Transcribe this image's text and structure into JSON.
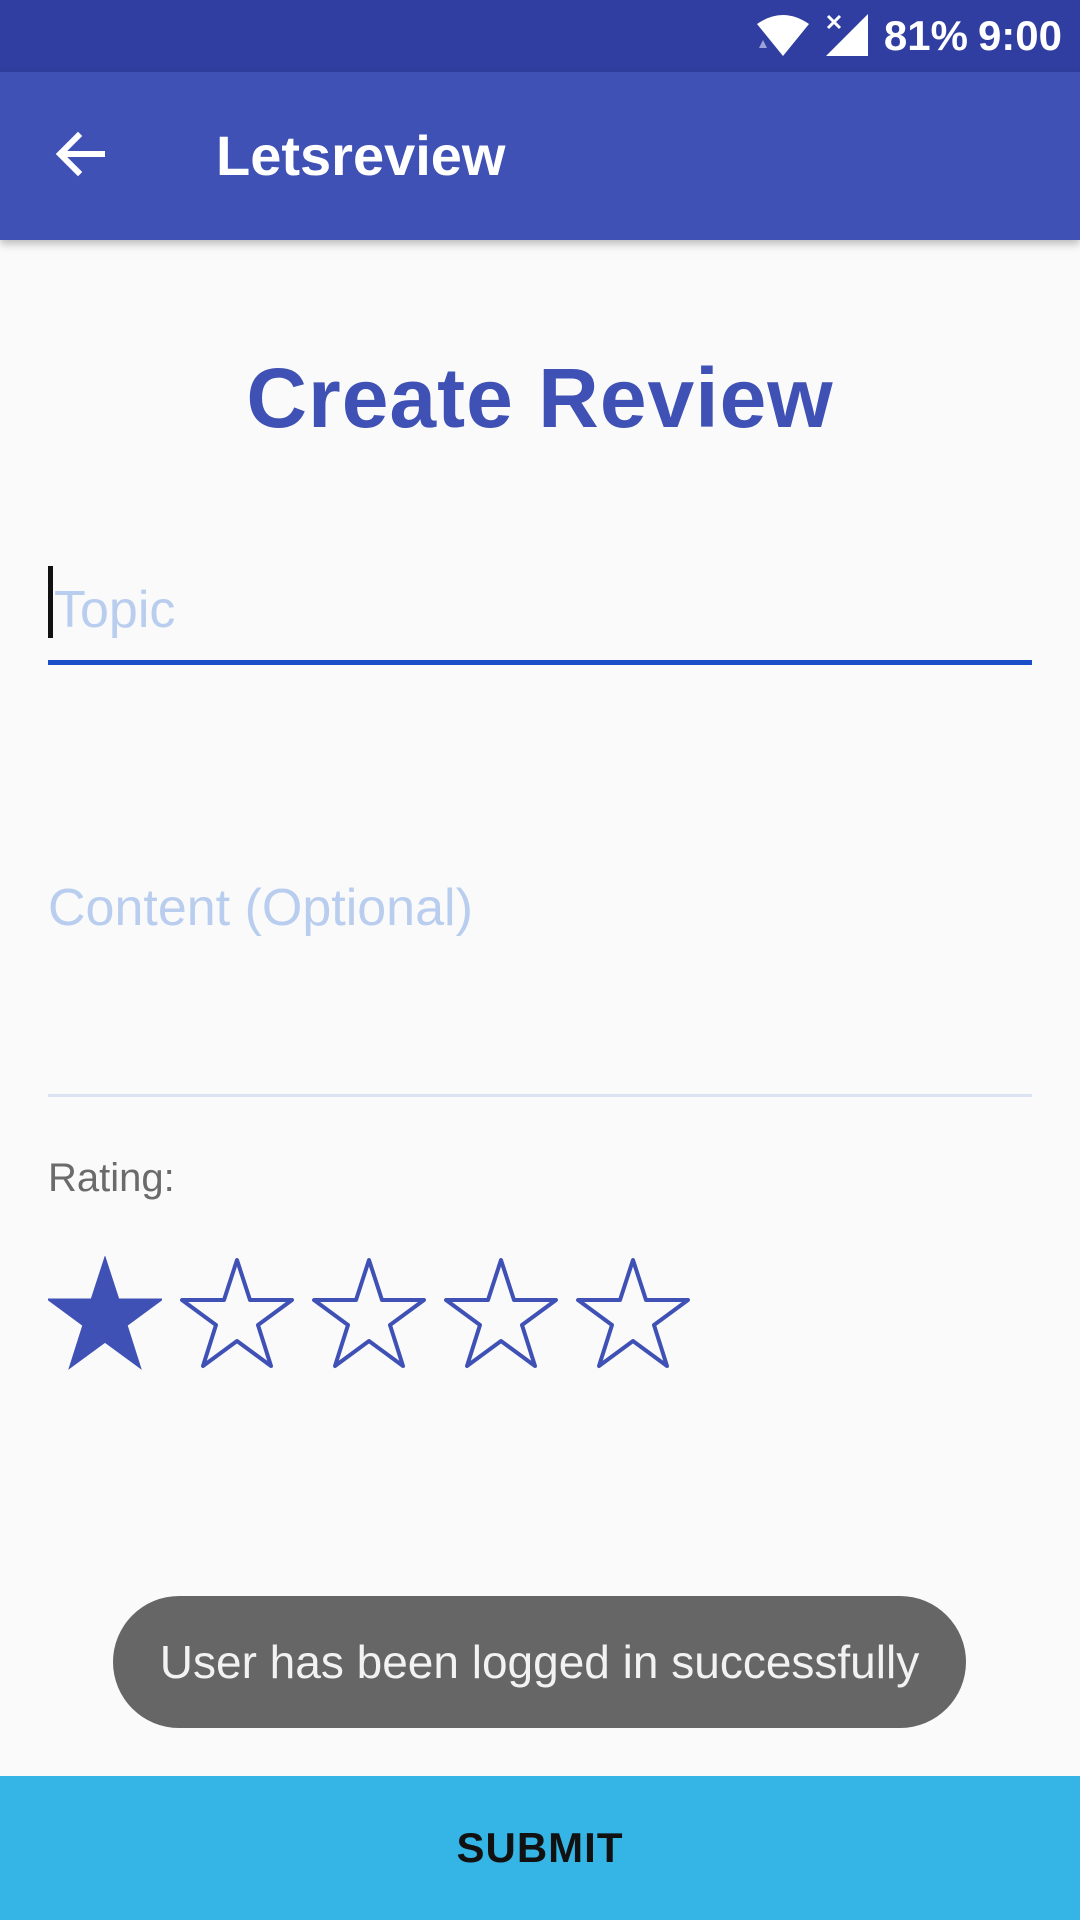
{
  "status_bar": {
    "battery": "81%",
    "time": "9:00",
    "icons": [
      "wifi-icon",
      "signal-icon"
    ]
  },
  "app_bar": {
    "title": "Letsreview",
    "back_icon": "arrow-left-icon"
  },
  "page": {
    "title": "Create Review"
  },
  "form": {
    "topic": {
      "value": "",
      "placeholder": "Topic"
    },
    "content": {
      "value": "",
      "placeholder": "Content (Optional)"
    },
    "rating_label": "Rating:",
    "rating": {
      "value": 1,
      "max": 5
    }
  },
  "toast": {
    "message": "User has been logged in successfully"
  },
  "submit": {
    "label": "SUBMIT"
  },
  "colors": {
    "status_bar": "#2f3ea0",
    "primary": "#3f51b5",
    "accent_underline": "#1a4fc9",
    "placeholder": "#b9cdef",
    "submit": "#35b4e6",
    "toast": "#666666"
  }
}
